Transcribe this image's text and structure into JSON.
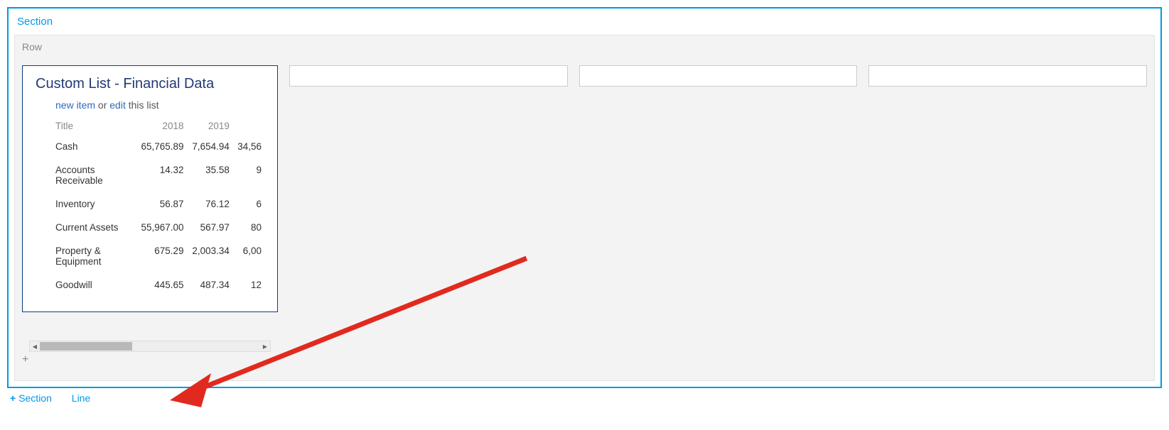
{
  "section": {
    "label": "Section"
  },
  "row": {
    "label": "Row"
  },
  "list": {
    "title": "Custom List - Financial Data",
    "actions": {
      "new": "new item",
      "or": " or ",
      "edit": "edit",
      "tail": " this list"
    },
    "columns": {
      "title": "Title",
      "y1": "2018",
      "y2": "2019",
      "y3": ""
    },
    "rows": [
      {
        "title": "Cash",
        "y1": "65,765.89",
        "y2": "7,654.94",
        "y3": "34,56"
      },
      {
        "title": "Accounts Receivable",
        "y1": "14.32",
        "y2": "35.58",
        "y3": "9"
      },
      {
        "title": "Inventory",
        "y1": "56.87",
        "y2": "76.12",
        "y3": "6"
      },
      {
        "title": "Current Assets",
        "y1": "55,967.00",
        "y2": "567.97",
        "y3": "80"
      },
      {
        "title": "Property & Equipment",
        "y1": "675.29",
        "y2": "2,003.34",
        "y3": "6,00"
      },
      {
        "title": "Goodwill",
        "y1": "445.65",
        "y2": "487.34",
        "y3": "12"
      }
    ]
  },
  "add_row_icon": "+",
  "add_bar": {
    "plus": "+",
    "section": "Section",
    "line": "Line"
  }
}
